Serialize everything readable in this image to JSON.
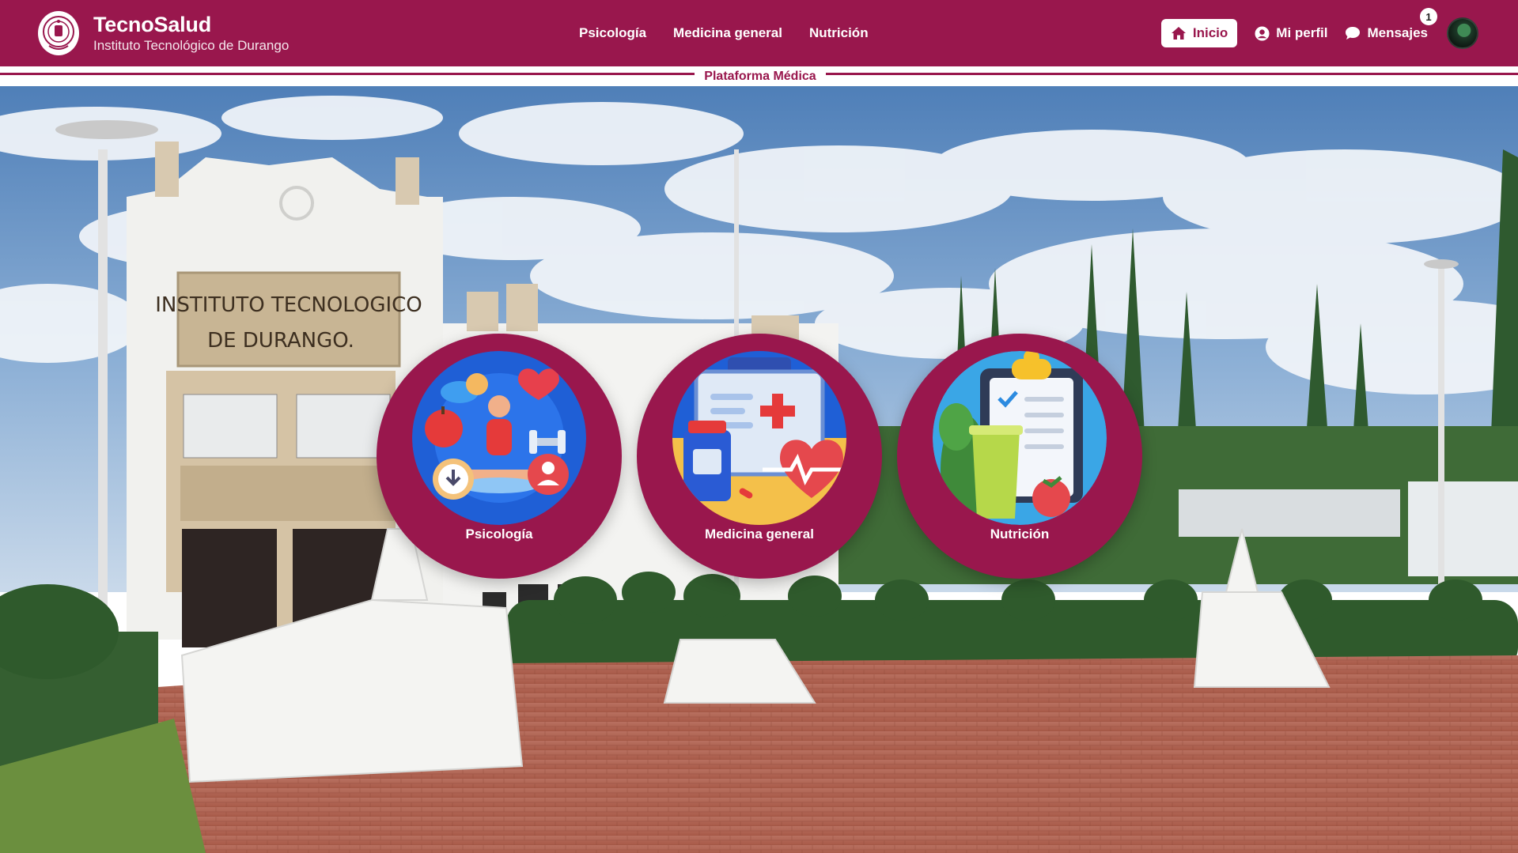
{
  "brand": {
    "title": "TecnoSalud",
    "subtitle": "Instituto Tecnológico de Durango",
    "logo_icon": "institution-seal-icon"
  },
  "nav": {
    "links": [
      {
        "label": "Psicología"
      },
      {
        "label": "Medicina general"
      },
      {
        "label": "Nutrición"
      }
    ],
    "inicio_label": "Inicio",
    "perfil_label": "Mi perfil",
    "mensajes_label": "Mensajes",
    "mensajes_count": "1"
  },
  "divider": {
    "label": "Plataforma Médica"
  },
  "hero": {
    "building_sign_line1": "INSTITUTO TECNOLOGICO",
    "building_sign_line2": "DE DURANGO."
  },
  "services": [
    {
      "label": "Psicología",
      "icon": "meditation-wellness-icon"
    },
    {
      "label": "Medicina general",
      "icon": "medical-kit-icon"
    },
    {
      "label": "Nutrición",
      "icon": "nutrition-clipboard-icon"
    }
  ],
  "colors": {
    "primary": "#99174d",
    "text_on_primary": "#ffffff"
  }
}
